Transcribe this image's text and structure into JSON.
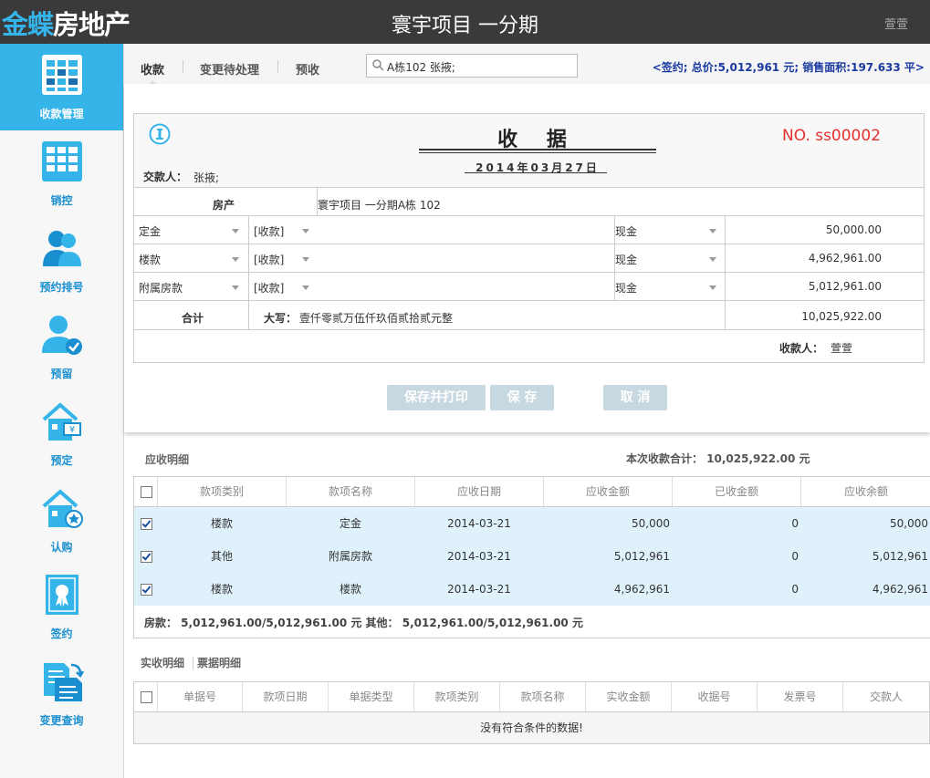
{
  "header": {
    "logo_part1": "金蝶",
    "logo_part2": "房地产",
    "project_title": "寰宇项目 一分期",
    "user": "萱萱"
  },
  "sidebar": {
    "items": [
      {
        "label": "收款管理",
        "icon": "grid-table-icon"
      },
      {
        "label": "销控",
        "icon": "grid-table-icon"
      },
      {
        "label": "预约排号",
        "icon": "users-icon"
      },
      {
        "label": "预留",
        "icon": "user-check-icon"
      },
      {
        "label": "预定",
        "icon": "house-money-icon"
      },
      {
        "label": "认购",
        "icon": "house-star-icon"
      },
      {
        "label": "签约",
        "icon": "certificate-icon"
      },
      {
        "label": "变更查询",
        "icon": "document-swap-icon"
      }
    ]
  },
  "tabs": [
    {
      "label": "收款"
    },
    {
      "label": "变更待处理"
    },
    {
      "label": "预收"
    }
  ],
  "search": {
    "value": "A栋102   张掖;"
  },
  "summary_top": "<签约; 总价:5,012,961 元;  销售面积:197.633 平>",
  "receipt": {
    "title": "收 据",
    "date": "2014年03月27日",
    "number": "NO. ss00002",
    "payer_label": "交款人：",
    "payer": "张掖;",
    "property_label": "房产",
    "property_value": "寰宇项目 一分期A栋 102",
    "lines": [
      {
        "item": "定金",
        "type": "[收款]",
        "method": "现金",
        "amount": "50,000.00"
      },
      {
        "item": "楼款",
        "type": "[收款]",
        "method": "现金",
        "amount": "4,962,961.00"
      },
      {
        "item": "附属房款",
        "type": "[收款]",
        "method": "现金",
        "amount": "5,012,961.00"
      }
    ],
    "total_label": "合计",
    "capital_label": "大写：",
    "capital_value": "壹仟零贰万伍仟玖佰贰拾贰元整",
    "total_amount": "10,025,922.00",
    "receiver_label": "收款人：",
    "receiver": "萱萱"
  },
  "buttons": {
    "save_print": "保存并打印",
    "save": "保 存",
    "cancel": "取 消"
  },
  "receivable": {
    "title": "应收明细",
    "total_text": "本次收款合计： 10,025,922.00 元",
    "columns": [
      "款项类别",
      "款项名称",
      "应收日期",
      "应收金额",
      "已收金额",
      "应收余额"
    ],
    "rows": [
      {
        "category": "楼款",
        "name": "定金",
        "date": "2014-03-21",
        "due": "50,000",
        "received": "0",
        "balance": "50,000"
      },
      {
        "category": "其他",
        "name": "附属房款",
        "date": "2014-03-21",
        "due": "5,012,961",
        "received": "0",
        "balance": "5,012,961"
      },
      {
        "category": "楼款",
        "name": "楼款",
        "date": "2014-03-21",
        "due": "4,962,961",
        "received": "0",
        "balance": "4,962,961"
      }
    ],
    "footer": "房款： 5,012,961.00/5,012,961.00 元    其他： 5,012,961.00/5,012,961.00 元"
  },
  "actual": {
    "tab1": "实收明细",
    "tab2": "票据明细",
    "columns": [
      "单据号",
      "款项日期",
      "单据类型",
      "款项类别",
      "款项名称",
      "实收金额",
      "收据号",
      "发票号",
      "交款人"
    ],
    "empty_text": "没有符合条件的数据!"
  },
  "colors": {
    "accent": "#35b4ea",
    "topbar": "#3a3a3a",
    "receipt_no": "#e53030",
    "row_highlight": "#dff2fb",
    "summary_text": "#1a3aa0"
  }
}
